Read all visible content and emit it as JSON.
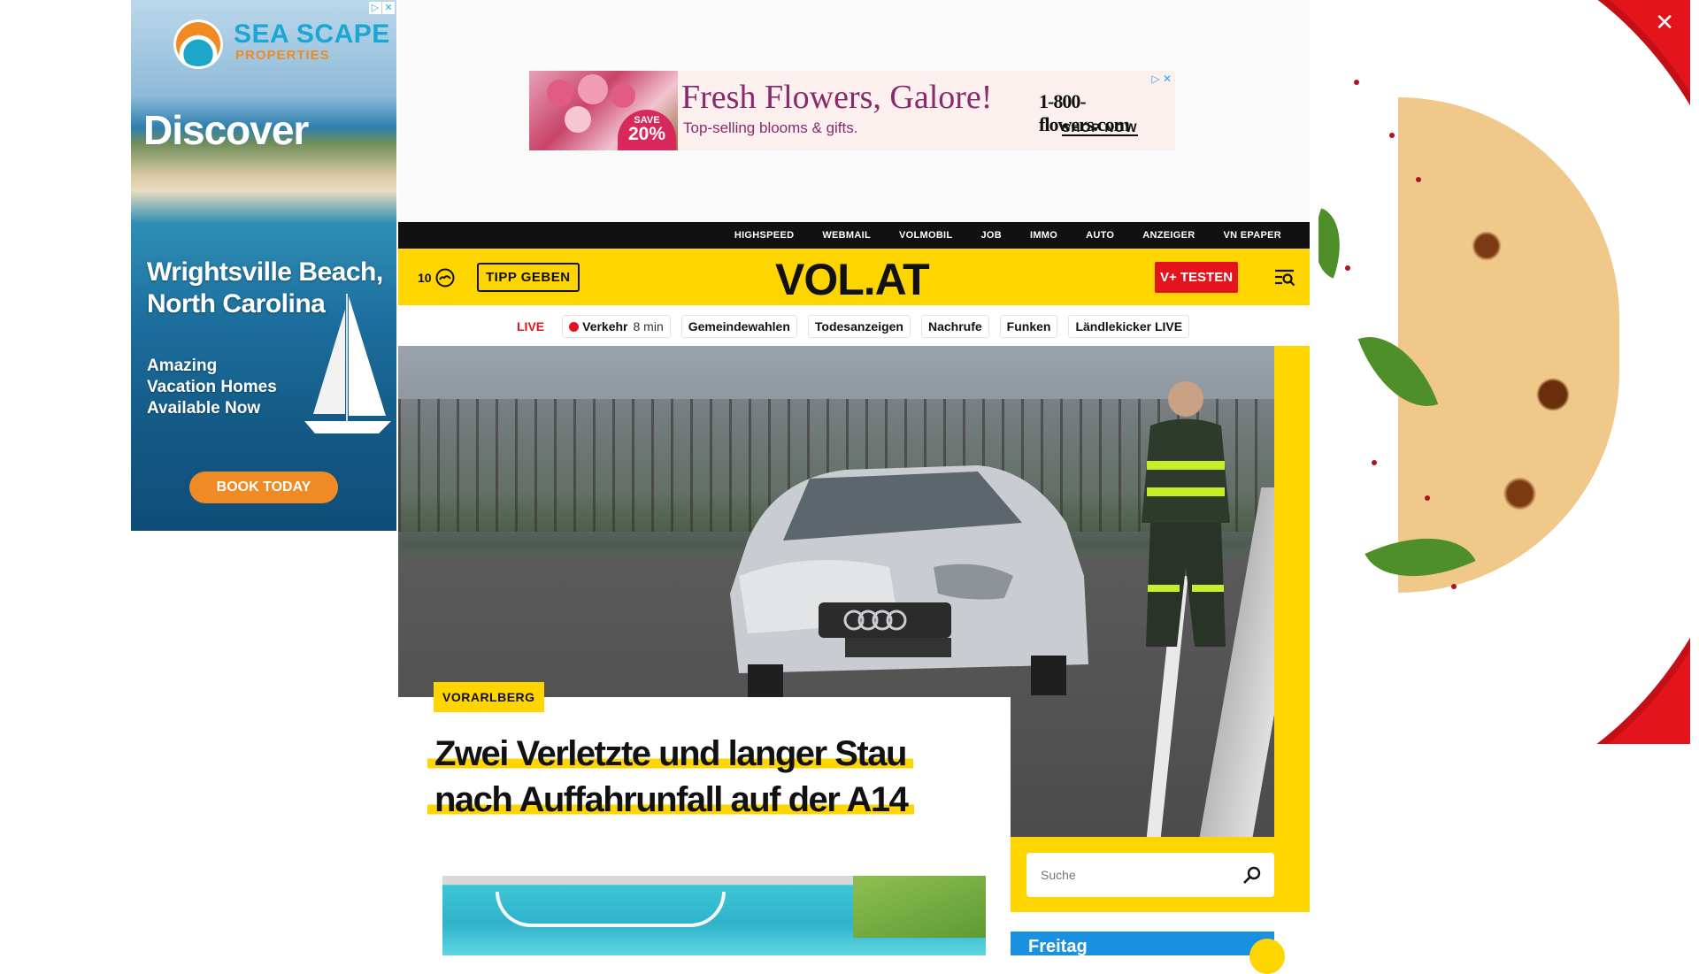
{
  "left_ad": {
    "brand": "SEA SCAPE",
    "brand_sub": "PROPERTIES",
    "headline": "Discover",
    "place": "Wrightsville Beach, North Carolina",
    "tagline": "Amazing Vacation Homes Available Now",
    "cta": "BOOK TODAY",
    "adchoices": [
      "▷",
      "✕"
    ],
    "colors": {
      "brand_blue": "#1aa7d4",
      "brand_orange": "#f08a24"
    }
  },
  "top_ad": {
    "headline": "Fresh Flowers, Galore!",
    "subline": "Top-selling blooms & gifts.",
    "badge_small": "SAVE",
    "badge_big": "20%",
    "brand": "1-800-flowers.com",
    "cta": "SHOP NOW",
    "adchoices": "▷ ✕"
  },
  "takeover": {
    "close_label": "✕",
    "background": "#e3141b"
  },
  "topnav": {
    "items": [
      "HIGHSPEED",
      "WEBMAIL",
      "VOLMOBIL",
      "JOB",
      "IMMO",
      "AUTO",
      "ANZEIGER",
      "VN EPAPER"
    ]
  },
  "header": {
    "temperature": "10",
    "weather_icon": "cloud-icon",
    "tipp_label": "TIPP GEBEN",
    "logo": "VOL.AT",
    "vplus_label": "V+ TESTEN",
    "menu_icon": "menu-search-icon",
    "colors": {
      "yellow": "#ffd500",
      "red": "#e3141b"
    }
  },
  "subnav": {
    "live_label": "LIVE",
    "items": [
      {
        "label": "Verkehr",
        "meta": "8 min",
        "live_dot": true
      },
      {
        "label": "Gemeindewahlen"
      },
      {
        "label": "Todesanzeigen"
      },
      {
        "label": "Nachrufe"
      },
      {
        "label": "Funken"
      },
      {
        "label": "Ländlekicker LIVE"
      }
    ]
  },
  "hero": {
    "category": "VORARLBERG",
    "headline": "Zwei Verletzte und langer Stau nach Auffahrunfall auf der A14"
  },
  "search": {
    "placeholder": "Suche",
    "icon": "search-icon"
  },
  "weather_card": {
    "day": "Freitag"
  }
}
